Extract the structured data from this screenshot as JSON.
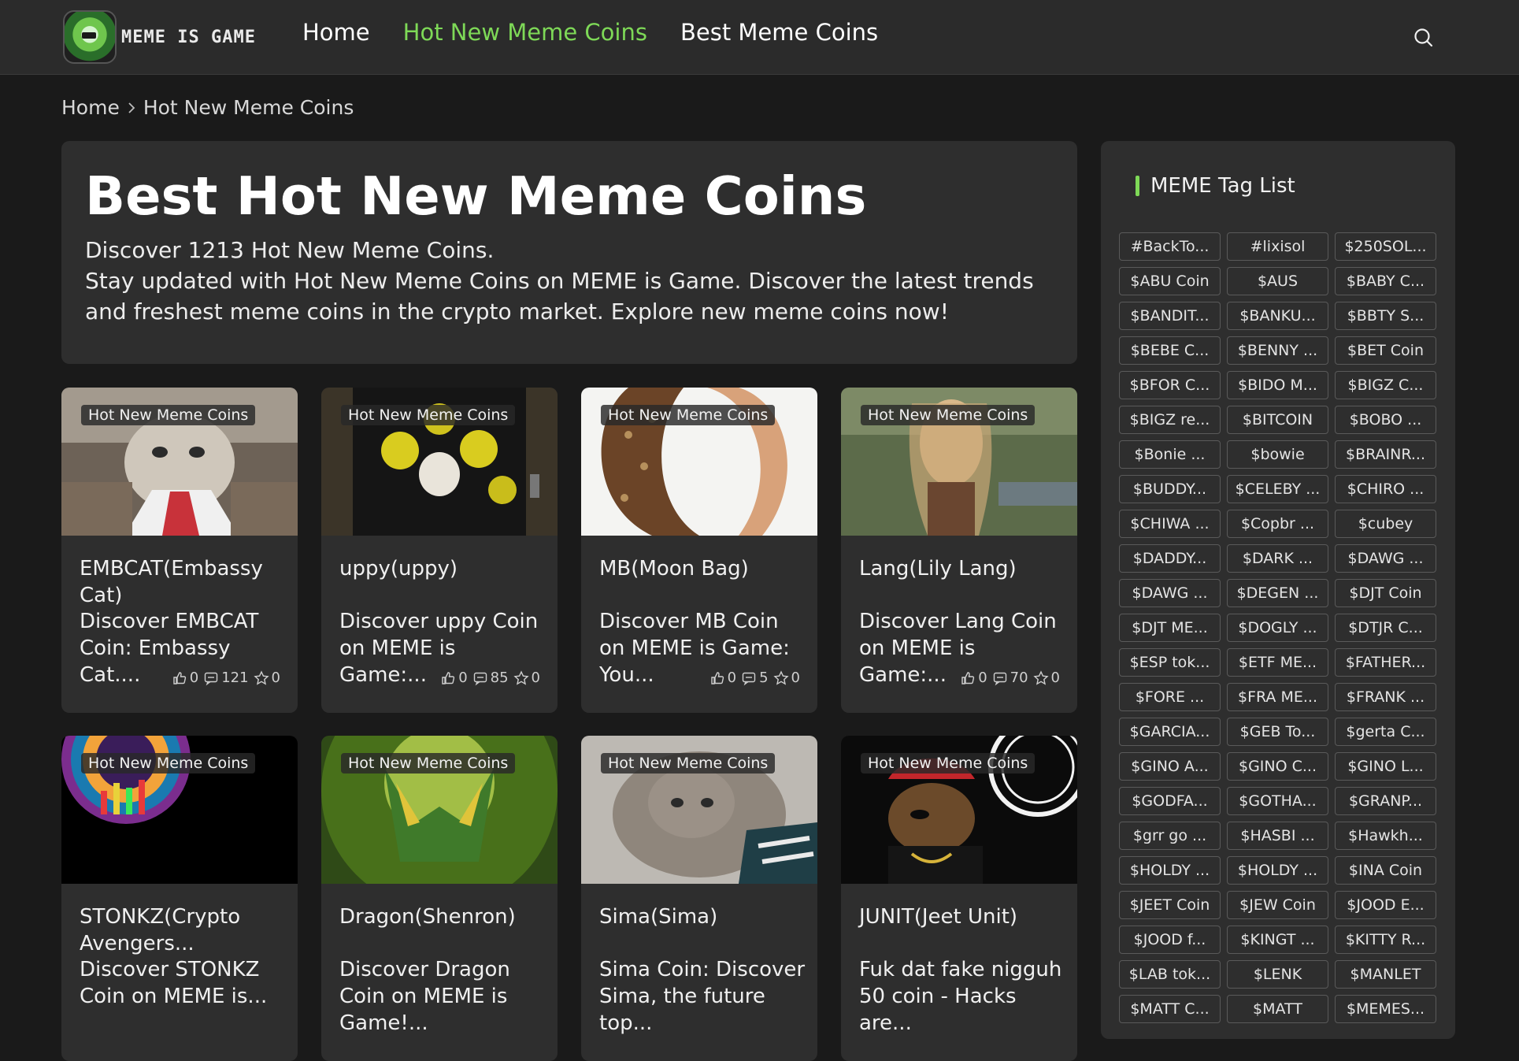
{
  "header": {
    "logo_text": "MEME IS GAME",
    "nav": [
      {
        "label": "Home",
        "active": false
      },
      {
        "label": "Hot New Meme Coins",
        "active": true
      },
      {
        "label": "Best Meme Coins",
        "active": false
      }
    ],
    "search_icon": "search-icon"
  },
  "breadcrumb": {
    "home": "Home",
    "separator_icon": "chevron-right-icon",
    "current": "Hot New Meme Coins"
  },
  "hero": {
    "title": "Best Hot New Meme Coins",
    "count_line": "Discover 1213 Hot New Meme Coins.",
    "description": "Stay updated with Hot New Meme Coins on MEME is Game. Discover the latest trends and freshest meme coins in the crypto market. Explore new meme coins now!"
  },
  "cards": [
    {
      "tag": "Hot New Meme Coins",
      "title": "EMBCAT(Embassy Cat)",
      "desc": "Discover EMBCAT Coin: Embassy Cat....",
      "likes": "0",
      "comments": "121",
      "favorites": "0"
    },
    {
      "tag": "Hot New Meme Coins",
      "title": "uppy(uppy)",
      "desc": "Discover uppy Coin on MEME is Game:...",
      "likes": "0",
      "comments": "85",
      "favorites": "0"
    },
    {
      "tag": "Hot New Meme Coins",
      "title": "MB(Moon Bag)",
      "desc": "Discover MB Coin on MEME is Game: You...",
      "likes": "0",
      "comments": "5",
      "favorites": "0"
    },
    {
      "tag": "Hot New Meme Coins",
      "title": "Lang(Lily Lang)",
      "desc": "Discover Lang Coin on MEME is Game:...",
      "likes": "0",
      "comments": "70",
      "favorites": "0"
    },
    {
      "tag": "Hot New Meme Coins",
      "title": "STONKZ(Crypto Avengers...",
      "desc": "Discover STONKZ Coin on MEME is...",
      "likes": "",
      "comments": "",
      "favorites": ""
    },
    {
      "tag": "Hot New Meme Coins",
      "title": "Dragon(Shenron)",
      "desc": "Discover Dragon Coin on MEME is Game!...",
      "likes": "",
      "comments": "",
      "favorites": ""
    },
    {
      "tag": "Hot New Meme Coins",
      "title": "Sima(Sima)",
      "desc": "Sima Coin: Discover Sima, the future top...",
      "likes": "",
      "comments": "",
      "favorites": ""
    },
    {
      "tag": "Hot New Meme Coins",
      "title": "JUNIT(Jeet Unit)",
      "desc": "Fuk dat fake nigguh 50 coin - Hacks are...",
      "likes": "",
      "comments": "",
      "favorites": ""
    }
  ],
  "sidebar": {
    "title": "MEME Tag List",
    "tags": [
      "#BackTo...",
      "#lixisol",
      "$250SOL...",
      "$ABU Coin",
      "$AUS",
      "$BABY C...",
      "$BANDIT...",
      "$BANKU...",
      "$BBTY S...",
      "$BEBE C...",
      "$BENNY ...",
      "$BET Coin",
      "$BFOR C...",
      "$BIDO M...",
      "$BIGZ C...",
      "$BIGZ re...",
      "$BITCOIN",
      "$BOBO ...",
      "$Bonie ...",
      "$bowie",
      "$BRAINR...",
      "$BUDDY...",
      "$CELEBY ...",
      "$CHIRO ...",
      "$CHIWA ...",
      "$Copbr ...",
      "$cubey",
      "$DADDY...",
      "$DARK ...",
      "$DAWG ...",
      "$DAWG ...",
      "$DEGEN ...",
      "$DJT Coin",
      "$DJT ME...",
      "$DOGLY ...",
      "$DTJR C...",
      "$ESP tok...",
      "$ETF ME...",
      "$FATHER...",
      "$FORE ...",
      "$FRA ME...",
      "$FRANK ...",
      "$GARCIA...",
      "$GEB To...",
      "$gerta C...",
      "$GINO A...",
      "$GINO C...",
      "$GINO L...",
      "$GODFA...",
      "$GOTHA...",
      "$GRANP...",
      "$grr go ...",
      "$HASBI ...",
      "$Hawkh...",
      "$HOLDY ...",
      "$HOLDY ...",
      "$INA Coin",
      "$JEET Coin",
      "$JEW Coin",
      "$JOOD E...",
      "$JOOD f...",
      "$KINGT ...",
      "$KITTY R...",
      "$LAB tok...",
      "$LENK",
      "$MANLET",
      "$MATT C...",
      "$MATT",
      "$MEMES..."
    ]
  },
  "colors": {
    "accent": "#7ed957",
    "background": "#1a1a1a",
    "panel": "#2e2e2e",
    "header": "#2b2b2b"
  }
}
